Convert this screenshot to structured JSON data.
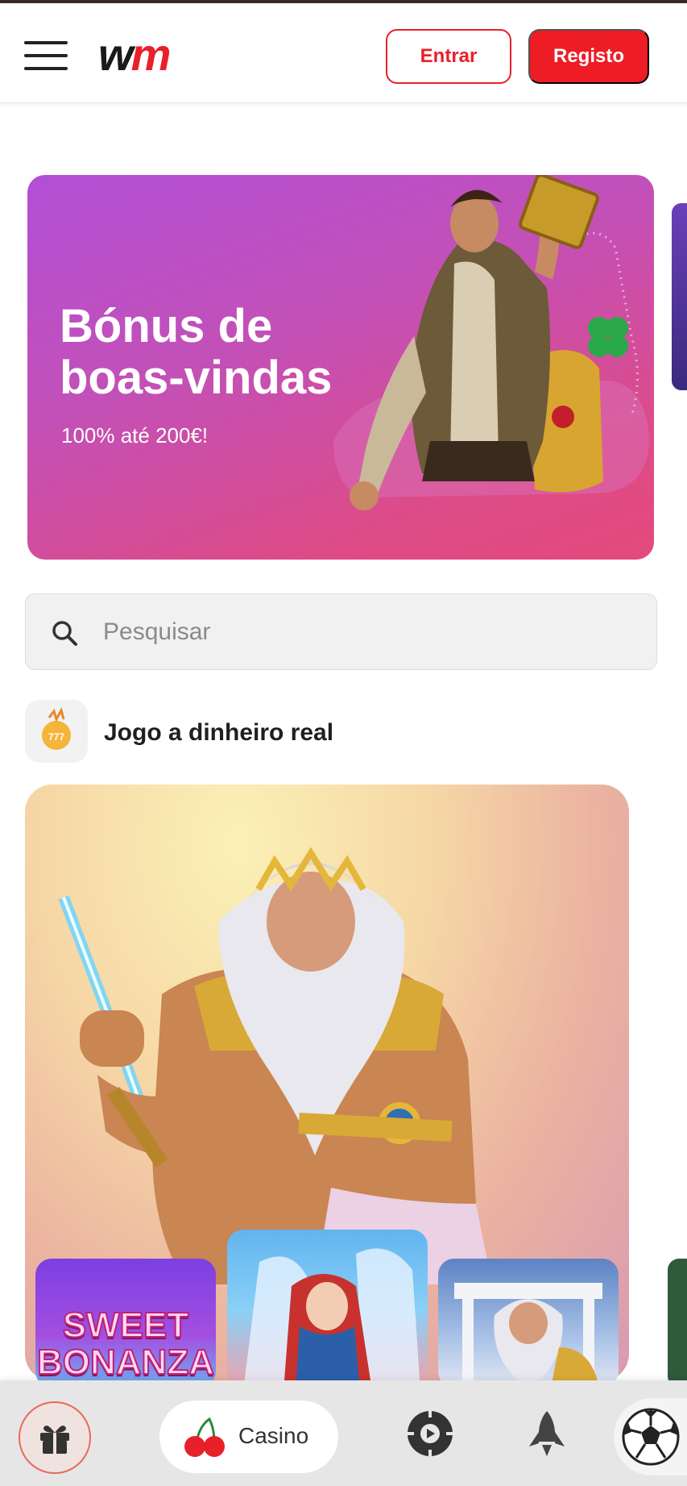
{
  "header": {
    "logo_w": "w",
    "logo_m": "m",
    "login_label": "Entrar",
    "register_label": "Registo"
  },
  "banner": {
    "title": "Bónus de boas-vindas",
    "subtitle": "100% até 200€!"
  },
  "search": {
    "placeholder": "Pesquisar"
  },
  "section": {
    "title": "Jogo a dinheiro real"
  },
  "games": {
    "thumb_1_text": "SWEET BONANZA"
  },
  "bottom_nav": {
    "casino_label": "Casino",
    "icons": [
      "gift-icon",
      "cherry-icon",
      "live-casino-icon",
      "rocket-icon",
      "soccer-ball-icon"
    ]
  },
  "colors": {
    "brand_red": "#ee1c25",
    "banner_top": "#b24fd6",
    "banner_bottom": "#e44a7c"
  }
}
